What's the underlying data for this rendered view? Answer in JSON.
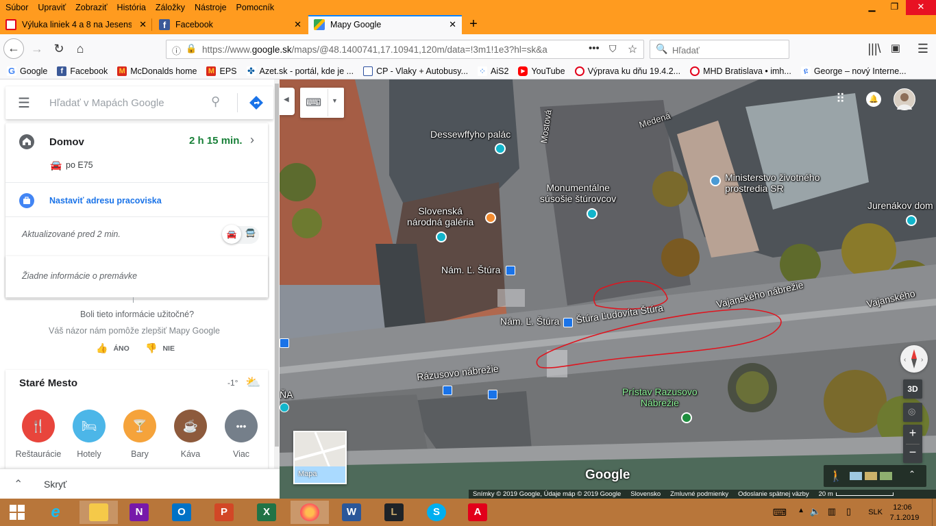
{
  "menu": [
    "Súbor",
    "Upraviť",
    "Zobraziť",
    "História",
    "Záložky",
    "Nástroje",
    "Pomocník"
  ],
  "tabs": [
    {
      "title": "Výluka liniek 4 a 8 na Jesenskéh",
      "icon": "dpb-icon",
      "color": "#e2001a"
    },
    {
      "title": "Facebook",
      "icon": "facebook-icon",
      "color": "#3b5998"
    },
    {
      "title": "Mapy Google",
      "icon": "google-maps-icon",
      "color": "#34a853"
    }
  ],
  "nav": {
    "url_prefix": "https://www.",
    "url_host": "google.sk",
    "url_rest": "/maps/@48.1400741,17.10941,120m/data=!3m1!1e3?hl=sk&a",
    "search_placeholder": "Hľadať"
  },
  "bookmarks": [
    {
      "label": "Google",
      "icon": "google-icon",
      "color": "#4285f4"
    },
    {
      "label": "Facebook",
      "icon": "facebook-icon",
      "color": "#3b5998"
    },
    {
      "label": "McDonalds home",
      "icon": "mcdonalds-icon",
      "color": "#ffc72c"
    },
    {
      "label": "EPS",
      "icon": "mcdonalds-icon",
      "color": "#ffc72c"
    },
    {
      "label": "Azet.sk - portál, kde je ...",
      "icon": "azet-icon",
      "color": "#0b5fa5"
    },
    {
      "label": "CP - Vlaky + Autobusy...",
      "icon": "cp-icon",
      "color": "#2b4f9e"
    },
    {
      "label": "AiS2",
      "icon": "ais-icon",
      "color": "#1a73e8"
    },
    {
      "label": "YouTube",
      "icon": "youtube-icon",
      "color": "#ff0000"
    },
    {
      "label": "Výprava ku dňu 19.4.2...",
      "icon": "dpb-icon",
      "color": "#e2001a"
    },
    {
      "label": "MHD Bratislava • imh...",
      "icon": "dpb-icon",
      "color": "#e2001a"
    },
    {
      "label": "George – nový Interne...",
      "icon": "george-icon",
      "color": "#2870ed"
    }
  ],
  "panel": {
    "search_placeholder": "Hľadať v Mapách Google",
    "home": {
      "title": "Domov",
      "time": "2 h 15 min.",
      "route": "po E75"
    },
    "work": {
      "label": "Nastaviť adresu pracoviska"
    },
    "updated": "Aktualizované pred 2 min.",
    "traffic": "Žiadne informácie o premávke",
    "feedback": {
      "question": "Boli tieto informácie užitočné?",
      "sub": "Váš názor nám pomôže zlepšiť Mapy Google",
      "yes": "ÁNO",
      "no": "NIE"
    },
    "area": {
      "name": "Staré Mesto",
      "temp": "-1°"
    },
    "categories": [
      {
        "label": "Reštaurácie",
        "icon": "restaurant-icon",
        "color": "#e8453c",
        "glyph": "🍴"
      },
      {
        "label": "Hotely",
        "icon": "hotel-icon",
        "color": "#4cb6e8",
        "glyph": "🛏"
      },
      {
        "label": "Bary",
        "icon": "bar-icon",
        "color": "#f5a33b",
        "glyph": "🍸"
      },
      {
        "label": "Káva",
        "icon": "coffee-icon",
        "color": "#8d5a3c",
        "glyph": "☕"
      },
      {
        "label": "Viac",
        "icon": "more-icon",
        "color": "#757f8a",
        "glyph": "•••"
      }
    ],
    "hide": "Skryť"
  },
  "map": {
    "labels": {
      "dessewffy": "Dessewffyho palác",
      "mostova": "Mostová",
      "medena": "Medená",
      "monument": "Monumentálne\nsúsošie štúrovcov",
      "ministry": "Ministerstvo životného\nprostredia SR",
      "jurenak": "Jurenákov dom",
      "sng": "Slovenská\nnárodná galéria",
      "nam1": "Nám. Ľ. Štúra",
      "nam2": "Nám. Ľ. Štúra",
      "vajanske1": "Vajanského nábrežie",
      "vajanske2": "Vajanského",
      "stur": "Štúra Ľudovíta Štúra",
      "razusovo": "Rázusovo nábrežie",
      "na": "ŇA",
      "pristav": "Prístav Razusovo\nNábrežie"
    },
    "minimap_label": "Mapa",
    "logo": "Google",
    "footer": [
      "Snímky © 2019 Google, Údaje máp © 2019 Google",
      "Slovensko",
      "Zmluvné podmienky",
      "Odoslanie spätnej väzby",
      "20 m"
    ],
    "btn_3d": "3D"
  },
  "tray": {
    "lang": "SLK",
    "time": "12:06",
    "date": "7.1.2019"
  }
}
